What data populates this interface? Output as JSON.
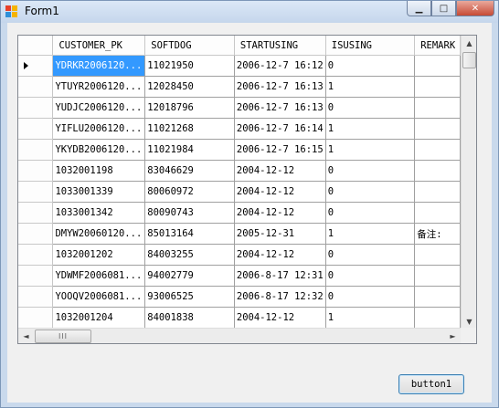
{
  "window": {
    "title": "Form1",
    "minimize_glyph": "▁",
    "maximize_glyph": "□",
    "close_glyph": "✕"
  },
  "grid": {
    "columns": [
      "CUSTOMER_PK",
      "SOFTDOG",
      "STARTUSING",
      "ISUSING",
      "REMARK"
    ],
    "rows": [
      [
        "YDRKR2006120...",
        "11021950",
        "2006-12-7 16:12",
        "0",
        ""
      ],
      [
        "YTUYR2006120...",
        "12028450",
        "2006-12-7 16:13",
        "1",
        ""
      ],
      [
        "YUDJC2006120...",
        "12018796",
        "2006-12-7 16:13",
        "0",
        ""
      ],
      [
        "YIFLU2006120...",
        "11021268",
        "2006-12-7 16:14",
        "1",
        ""
      ],
      [
        "YKYDB2006120...",
        "11021984",
        "2006-12-7 16:15",
        "1",
        ""
      ],
      [
        "1032001198",
        "83046629",
        "2004-12-12",
        "0",
        ""
      ],
      [
        "1033001339",
        "80060972",
        "2004-12-12",
        "0",
        ""
      ],
      [
        "1033001342",
        "80090743",
        "2004-12-12",
        "0",
        ""
      ],
      [
        "DMYW20060120...",
        "85013164",
        "2005-12-31",
        "1",
        "备注:"
      ],
      [
        "1032001202",
        "84003255",
        "2004-12-12",
        "0",
        ""
      ],
      [
        "YDWMF2006081...",
        "94002779",
        "2006-8-17 12:31",
        "0",
        ""
      ],
      [
        "YOOQV2006081...",
        "93006525",
        "2006-8-17 12:32",
        "0",
        ""
      ],
      [
        "1032001204",
        "84001838",
        "2004-12-12",
        "1",
        ""
      ],
      [
        "",
        "",
        "",
        "",
        ""
      ]
    ],
    "selected_row": 0,
    "selected_col": 0
  },
  "scroll": {
    "up": "▲",
    "down": "▼",
    "left": "◄",
    "right": "►",
    "grip": "III"
  },
  "button1": {
    "label": "button1"
  }
}
